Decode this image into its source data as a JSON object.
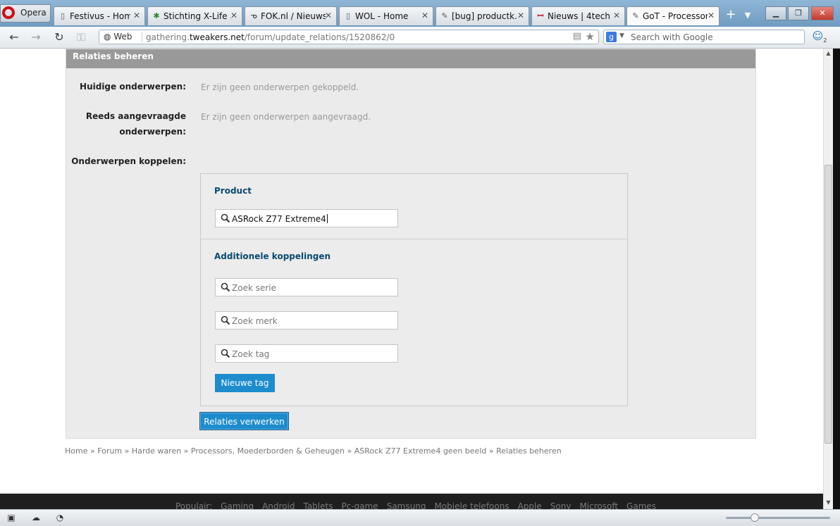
{
  "browser": {
    "menu_label": "Opera",
    "tabs": [
      {
        "title": "Festivus - Home",
        "fav": "doc-icon"
      },
      {
        "title": "Stichting X-Life ...",
        "fav": "palm-icon"
      },
      {
        "title": "FOK.nl / Nieuws...",
        "fav": "fok-icon"
      },
      {
        "title": "WOL - Home",
        "fav": "doc-icon"
      },
      {
        "title": "[bug] productk...",
        "fav": "wrench-icon"
      },
      {
        "title": "Nieuws | 4tech",
        "fav": "4tech-icon"
      },
      {
        "title": "GoT - Processor...",
        "fav": "wrench-icon",
        "active": true
      }
    ],
    "address": {
      "web_label": "Web",
      "url_prefix": "gathering.",
      "url_domain": "tweakers.net",
      "url_path": "/forum/update_relations/1520862/0"
    },
    "search": {
      "placeholder": "Search with Google"
    },
    "unite_badge": "2"
  },
  "page": {
    "panel_title": "Relaties beheren",
    "rows": {
      "current_label": "Huidige onderwerpen:",
      "current_value": "Er zijn geen onderwerpen gekoppeld.",
      "requested_label_1": "Reeds aangevraagde",
      "requested_label_2": "onderwerpen:",
      "requested_value": "Er zijn geen onderwerpen aangevraagd.",
      "link_label": "Onderwerpen koppelen:"
    },
    "product": {
      "title": "Product",
      "value": "ASRock Z77 Extreme4"
    },
    "additional": {
      "title": "Additionele koppelingen",
      "series_placeholder": "Zoek serie",
      "brand_placeholder": "Zoek merk",
      "tag_placeholder": "Zoek tag",
      "new_tag_button": "Nieuwe tag"
    },
    "submit_button": "Relaties verwerken",
    "breadcrumb": [
      "Home",
      "Forum",
      "Harde waren",
      "Processors, Moederborden & Geheugen",
      "ASRock Z77 Extreme4 geen beeld",
      "Relaties beheren"
    ],
    "breadcrumb_sep": " » ",
    "footer": {
      "popular_label": "Populair:",
      "links": [
        "Gaming",
        "Android",
        "Tablets",
        "Pc-game",
        "Samsung",
        "Mobiele telefoons",
        "Apple",
        "Sony",
        "Microsoft",
        "Games"
      ]
    }
  },
  "colors": {
    "accent_blue": "#1d8ccd",
    "section_title": "#0a4a70",
    "panel_header": "#999999"
  }
}
